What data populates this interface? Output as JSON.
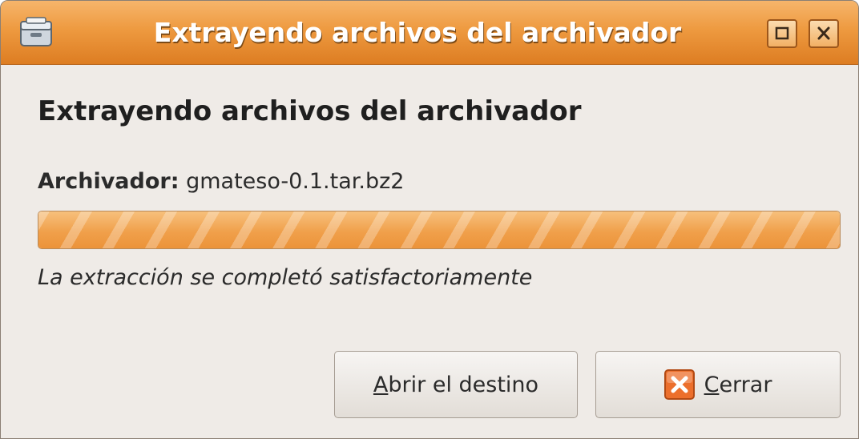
{
  "window": {
    "title": "Extrayendo archivos del archivador"
  },
  "dialog": {
    "heading": "Extrayendo archivos del archivador",
    "archive_label": "Archivador:",
    "archive_name": "gmateso-0.1.tar.bz2",
    "progress_fraction": 1.0,
    "status_text": "La extracción se completó satisfactoriamente"
  },
  "buttons": {
    "open_mnemonic": "A",
    "open_rest": "brir el destino",
    "close_mnemonic": "C",
    "close_rest": "errar"
  },
  "icons": {
    "app": "archive-manager-icon",
    "maximize": "maximize-icon",
    "close": "close-icon",
    "close_button": "close-x-icon"
  },
  "colors": {
    "titlebar": "#ee9a40",
    "progress": "#f0a04b",
    "close_icon": "#e8662a"
  }
}
